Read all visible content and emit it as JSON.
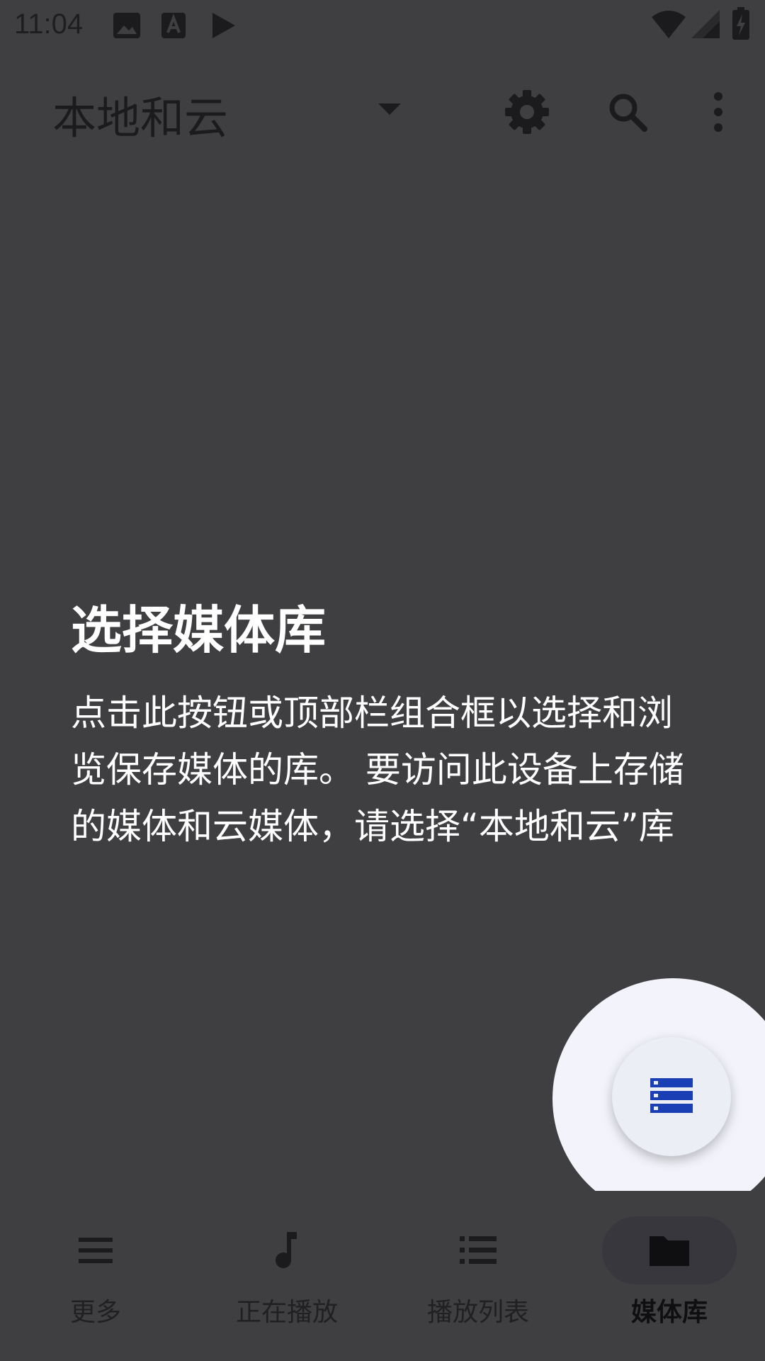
{
  "status_bar": {
    "time": "11:04",
    "icons": [
      "gallery-icon",
      "text-a-icon",
      "play-icon",
      "wifi-icon",
      "cellular-signal-icon",
      "battery-charging-icon"
    ]
  },
  "app_bar": {
    "library_title": "本地和云",
    "icons": [
      "dropdown-arrow-icon",
      "settings-gear-icon",
      "search-icon",
      "more-vertical-icon"
    ]
  },
  "empty_state": {
    "title": "选择媒体库",
    "body": "点击此按钮或顶部栏组合框以选择和浏览保存媒体的库。 要访问此设备上存储的媒体和云媒体，请选择“本地和云”库"
  },
  "fab": {
    "icon": "library-list-icon",
    "accent_color": "#1a3fb5"
  },
  "bottom_nav": {
    "items": [
      {
        "label": "更多",
        "icon": "menu-icon",
        "active": false
      },
      {
        "label": "正在播放",
        "icon": "music-note-icon",
        "active": false
      },
      {
        "label": "播放列表",
        "icon": "playlist-icon",
        "active": false
      },
      {
        "label": "媒体库",
        "icon": "folder-icon",
        "active": true
      }
    ]
  },
  "colors": {
    "background": "#3f3f42",
    "dark_icon": "#1b1b1d",
    "highlight": "#f3f4fb",
    "accent": "#1a3fb5"
  }
}
